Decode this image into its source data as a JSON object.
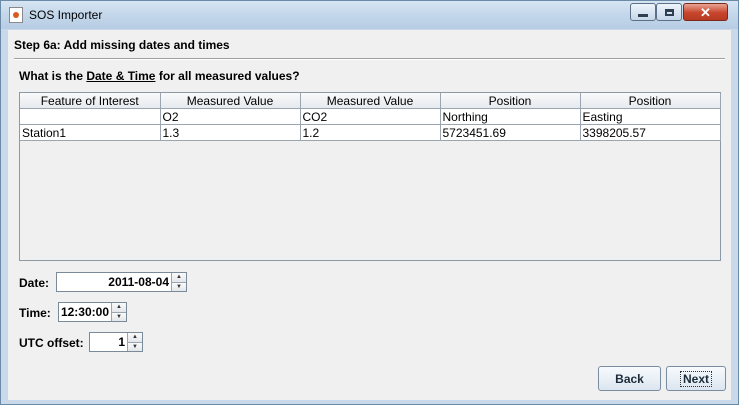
{
  "window": {
    "title": "SOS Importer"
  },
  "step": {
    "title": "Step 6a: Add missing dates and times"
  },
  "question": {
    "prefix": "What is the ",
    "emphasis": "Date & Time",
    "suffix": " for all measured values?"
  },
  "table": {
    "headers": [
      "Feature of Interest",
      "Measured Value",
      "Measured Value",
      "Position",
      "Position"
    ],
    "rows": [
      [
        "",
        "O2",
        "CO2",
        "Northing",
        "Easting"
      ],
      [
        "Station1",
        "1.3",
        "1.2",
        "5723451.69",
        "3398205.57"
      ]
    ]
  },
  "date": {
    "label": "Date:",
    "value": "2011-08-04"
  },
  "time": {
    "label": "Time:",
    "value": "12:30:00"
  },
  "utc": {
    "label": "UTC offset:",
    "value": "1"
  },
  "buttons": {
    "back": "Back",
    "next": "Next"
  },
  "icons": {
    "app": "java-app-icon",
    "spin_up": "▲",
    "spin_down": "▼"
  }
}
